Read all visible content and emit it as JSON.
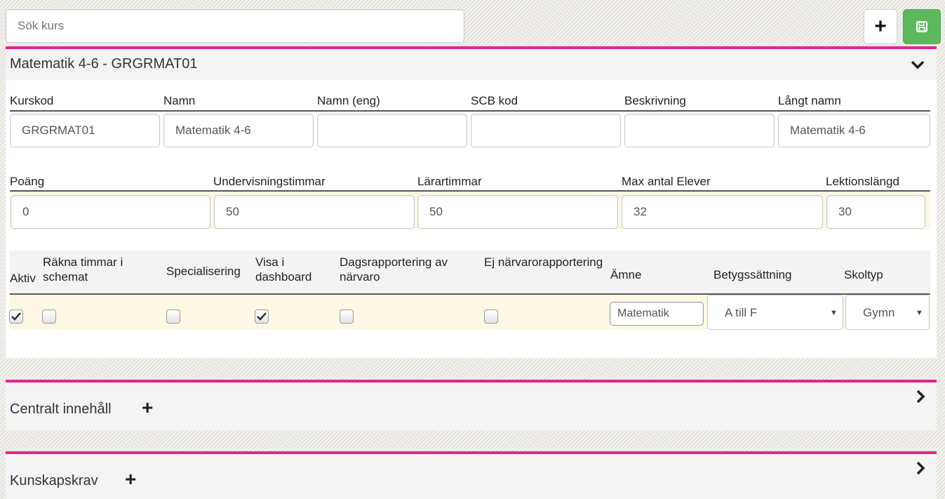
{
  "search": {
    "placeholder": "Sök kurs"
  },
  "toolbar": {
    "add_symbol": "+",
    "save_icon": "floppy-disk-icon"
  },
  "colors": {
    "accent": "#e1258a",
    "save_green": "#5cb85c",
    "row_highlight": "#fcf8e3"
  },
  "course": {
    "title": "Matematik 4-6 - GRGRMAT01",
    "labels_row1": [
      "Kurskod",
      "Namn",
      "Namn (eng)",
      "SCB kod",
      "Beskrivning",
      "Långt namn"
    ],
    "values_row1": [
      "GRGRMAT01",
      "Matematik 4-6",
      "",
      "",
      "",
      "Matematik 4-6"
    ],
    "labels_row2": [
      "Poäng",
      "Undervisningstimmar",
      "Lärartimmar",
      "Max antal Elever",
      "Lektionslängd"
    ],
    "values_row2": [
      "0",
      "50",
      "50",
      "32",
      "30"
    ],
    "flags": {
      "aktiv": "Aktiv",
      "rakna": "Räkna timmar i schemat",
      "special": "Specialisering",
      "visa": "Visa i dashboard",
      "dags": "Dagsrapportering av närvaro",
      "ej": "Ej närvarorapportering",
      "amne": "Ämne",
      "betyg": "Betygssättning",
      "skoltyp": "Skoltyp"
    },
    "checked": {
      "aktiv": true,
      "rakna": false,
      "special": false,
      "visa": true,
      "dags": false,
      "ej": false
    },
    "amne_value": "Matematik",
    "betyg_value": "A till F",
    "skoltyp_value": "Gymnasieskola",
    "skoltyp_visible": "Gymn"
  },
  "sections": [
    {
      "title": "Centralt innehåll",
      "add_symbol": "+"
    },
    {
      "title": "Kunskapskrav",
      "add_symbol": "+"
    }
  ]
}
